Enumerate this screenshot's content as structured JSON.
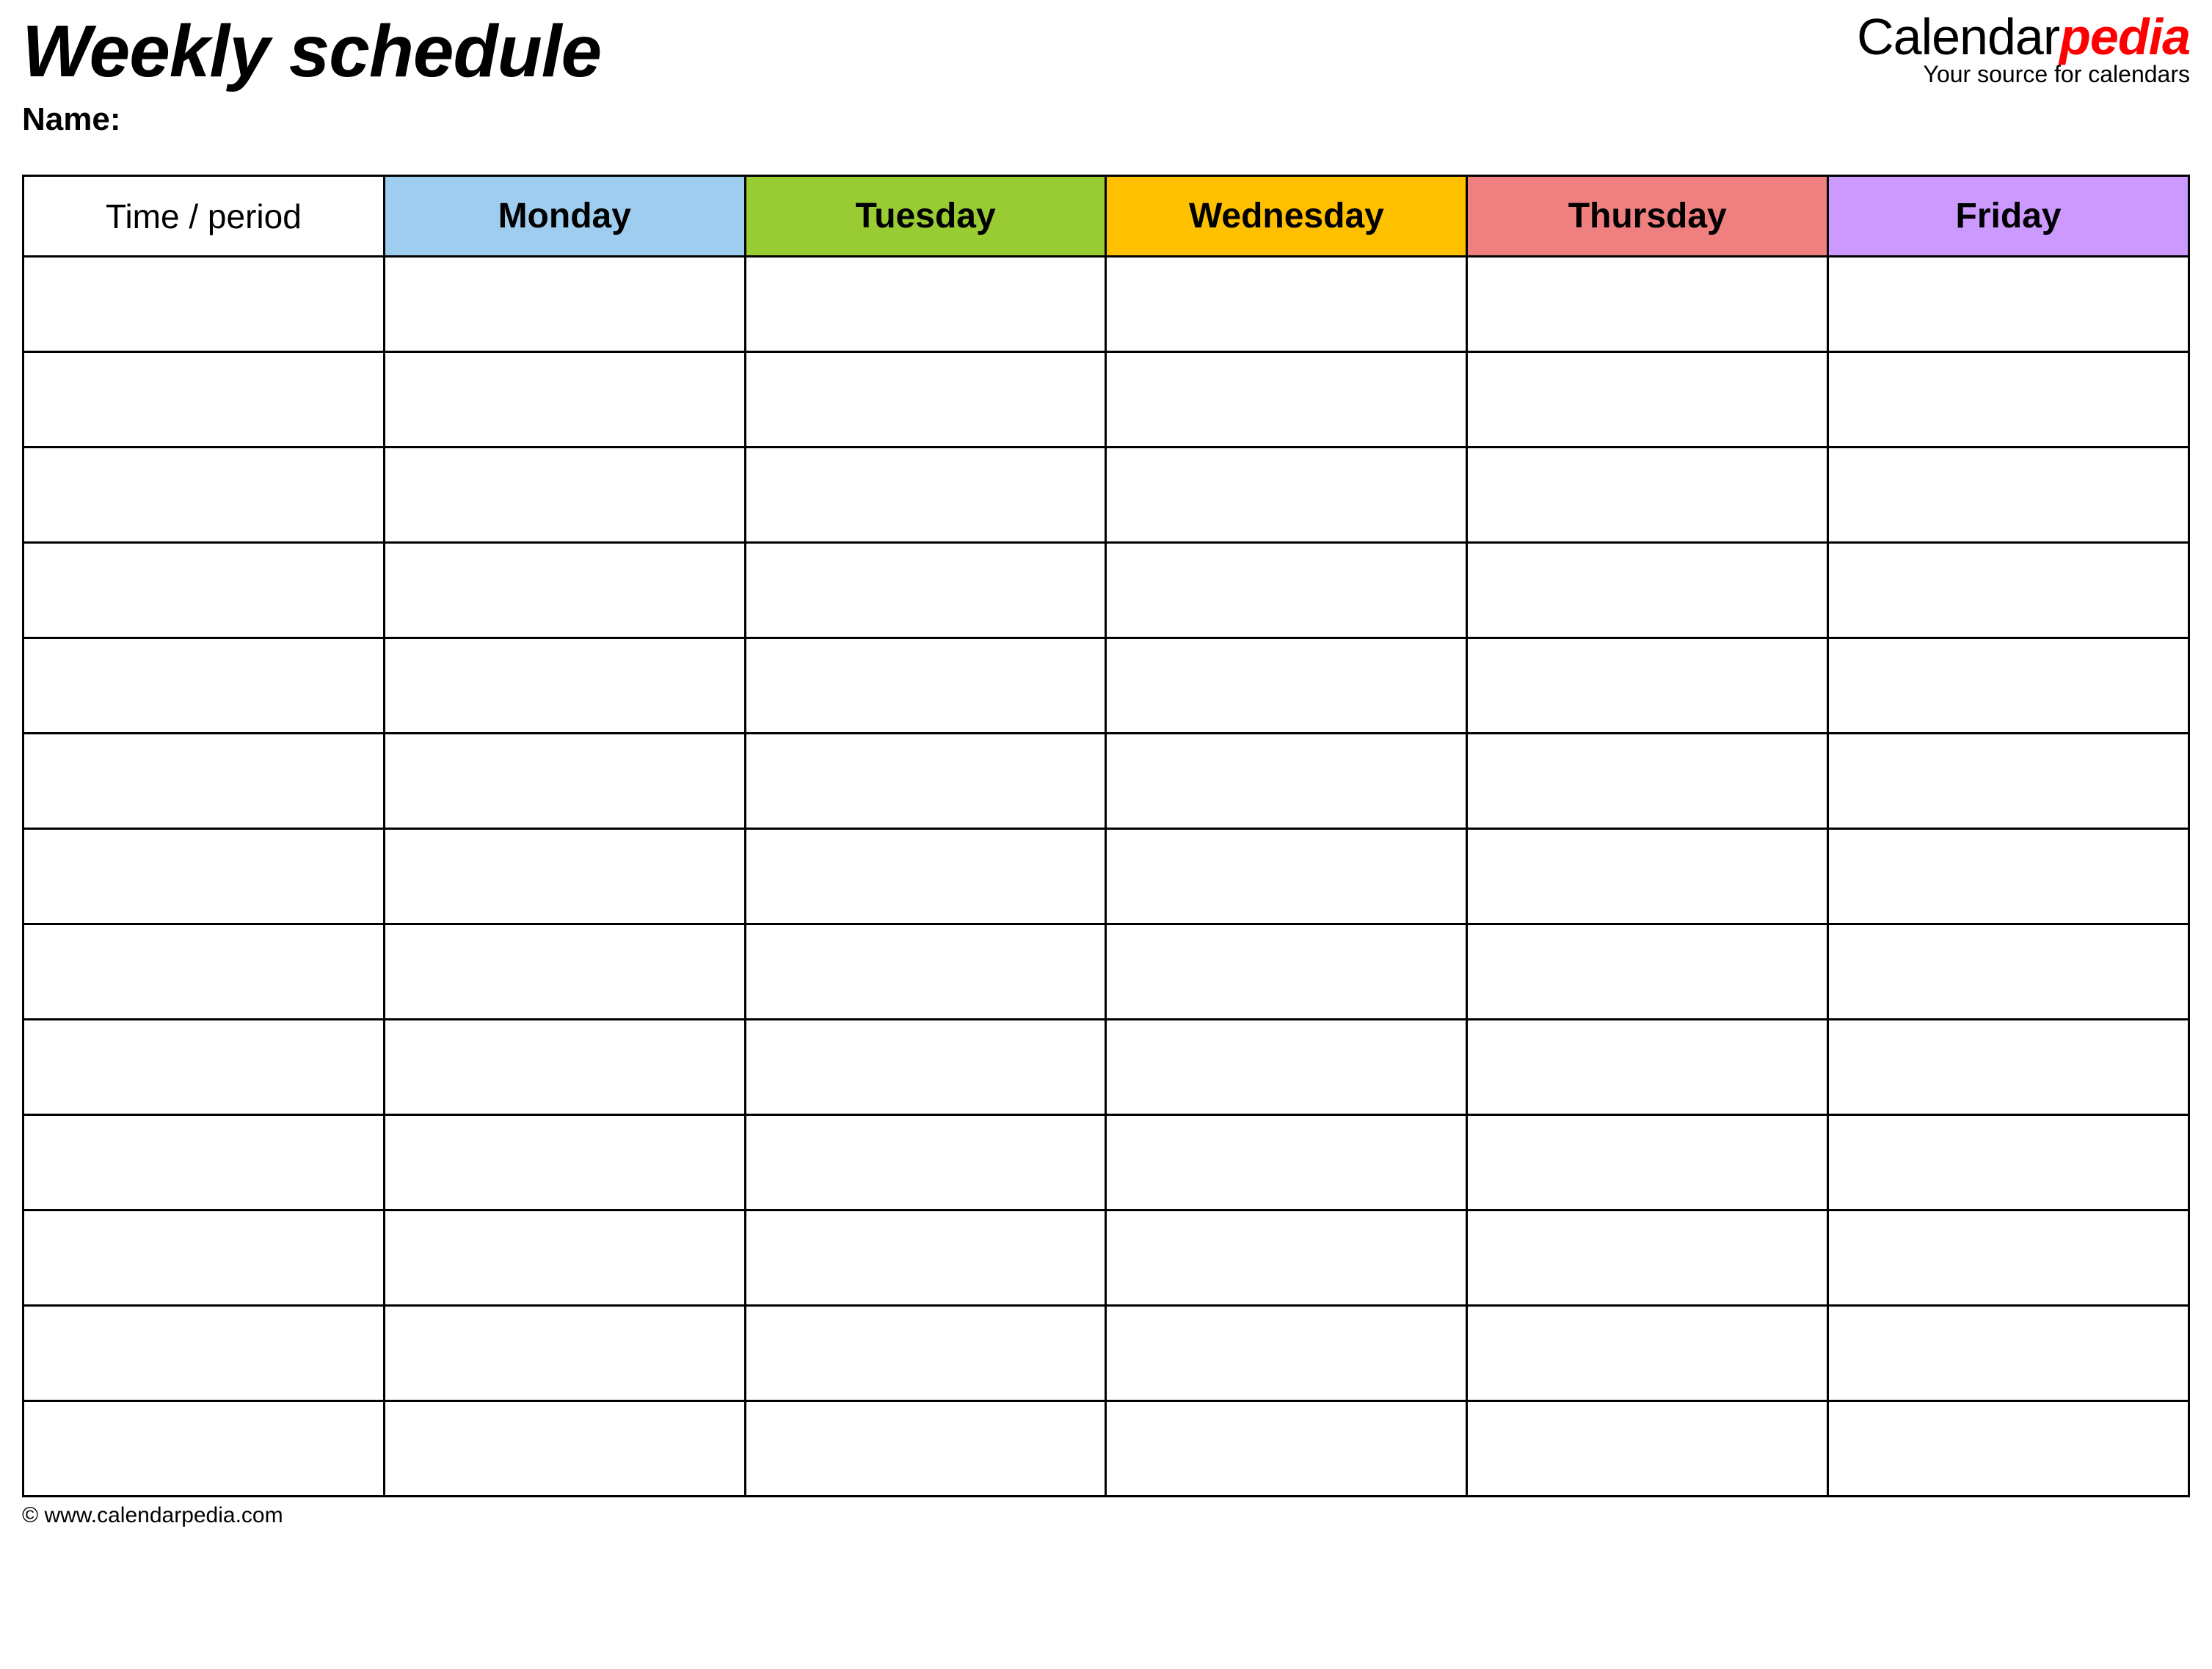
{
  "header": {
    "title": "Weekly schedule",
    "name_label": "Name:"
  },
  "brand": {
    "part1": "Calendar",
    "part2": "pedia",
    "tagline": "Your source for calendars"
  },
  "table": {
    "columns": [
      {
        "label": "Time / period",
        "bg": "#ffffff"
      },
      {
        "label": "Monday",
        "bg": "#9fcdf0"
      },
      {
        "label": "Tuesday",
        "bg": "#99cc33"
      },
      {
        "label": "Wednesday",
        "bg": "#ffc000"
      },
      {
        "label": "Thursday",
        "bg": "#f08080"
      },
      {
        "label": "Friday",
        "bg": "#cc99ff"
      }
    ],
    "row_count": 13
  },
  "footer": {
    "copyright": "© www.calendarpedia.com"
  }
}
